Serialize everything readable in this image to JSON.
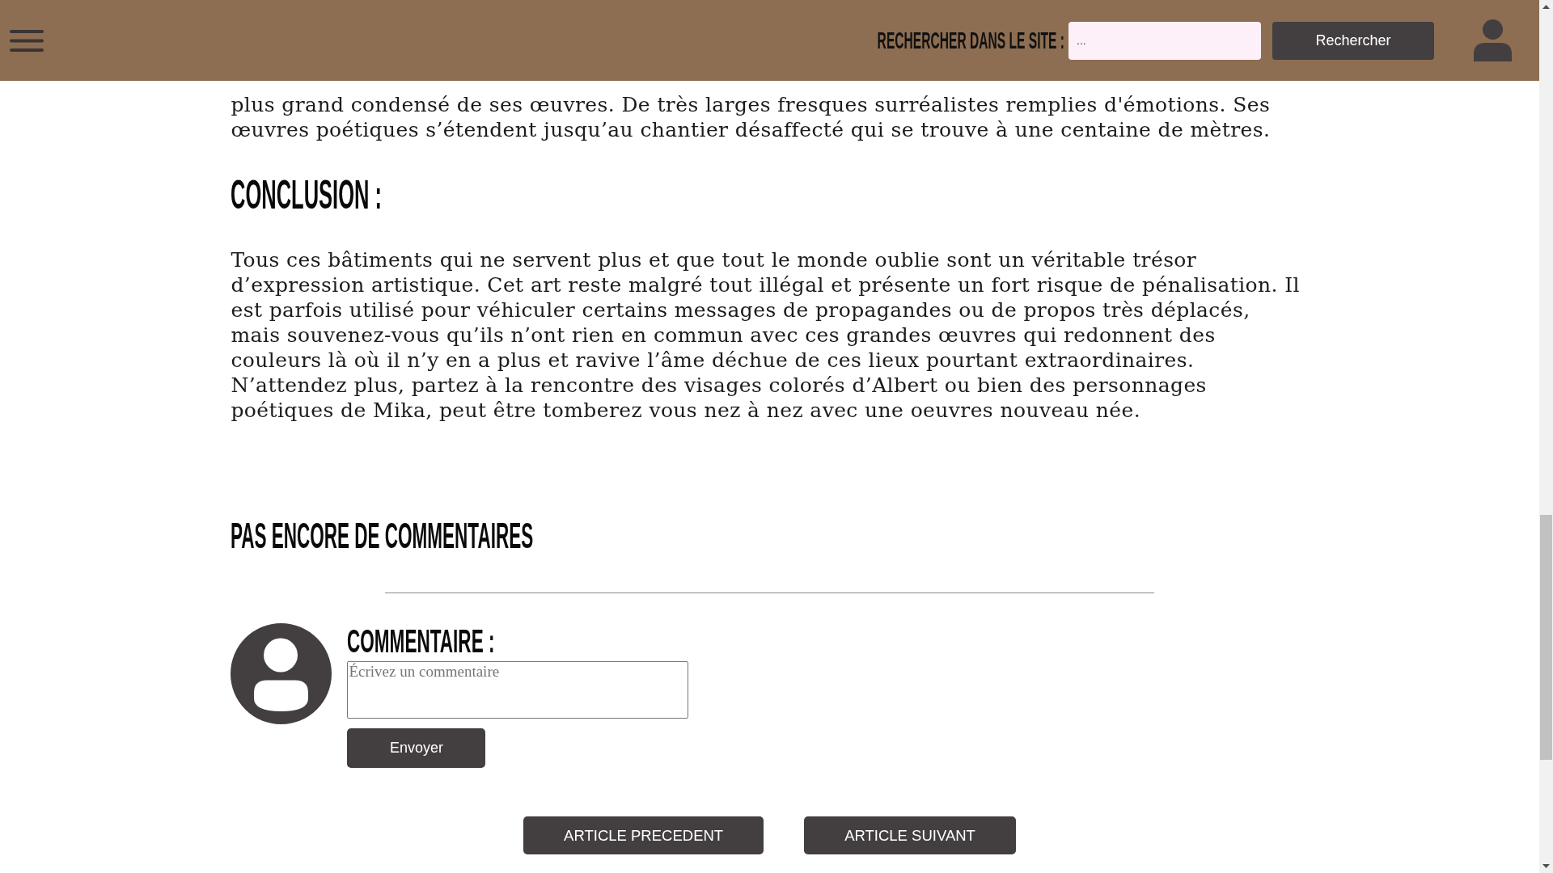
{
  "header": {
    "search_label": "RECHERCHER DANS LE SITE :",
    "search": {
      "placeholder": "..."
    },
    "search_button": "Rechercher"
  },
  "article": {
    "blocks": [
      {
        "kind": "paragraph",
        "lines": [
          "plus grand condensé de ses œuvres. De très larges fresques surréalistes remplies d'émotions. Ses",
          "œuvres poétiques s’étendent jusqu’au chantier désaffecté qui se trouve à une centaine de mètres."
        ]
      },
      {
        "kind": "heading",
        "text": "CONCLUSION :"
      },
      {
        "kind": "paragraph",
        "lines": [
          "Tous ces bâtiments qui ne servent plus et que tout le monde oublie sont un véritable trésor",
          "d’expression artistique. Cet art reste malgré tout illégal et présente un fort risque de pénalisation. Il",
          "est parfois utilisé pour véhiculer certains messages de propagandes ou de propos très déplacés,",
          "mais souvenez-vous qu’ils n’ont rien en commun avec ces grandes œuvres qui redonnent des",
          "couleurs là où il n’y en a plus et ravive l’âme déchue de ces lieux pourtant extraordinaires.",
          "N’attendez plus, partez à la rencontre des visages colorés d’Albert ou bien des personnages",
          "poétiques de Mika, peut être tomberez vous nez à nez avec une oeuvres nouveau née."
        ]
      }
    ]
  },
  "comments": {
    "title": "PAS ENCORE DE COMMENTAIRES",
    "form": {
      "label": "COMMENTAIRE :",
      "placeholder": "Écrivez un commentaire",
      "submit": "Envoyer"
    }
  },
  "navigation": {
    "buttons": [
      "ARTICLE PRECEDENT",
      "ARTICLE SUIVANT"
    ]
  }
}
